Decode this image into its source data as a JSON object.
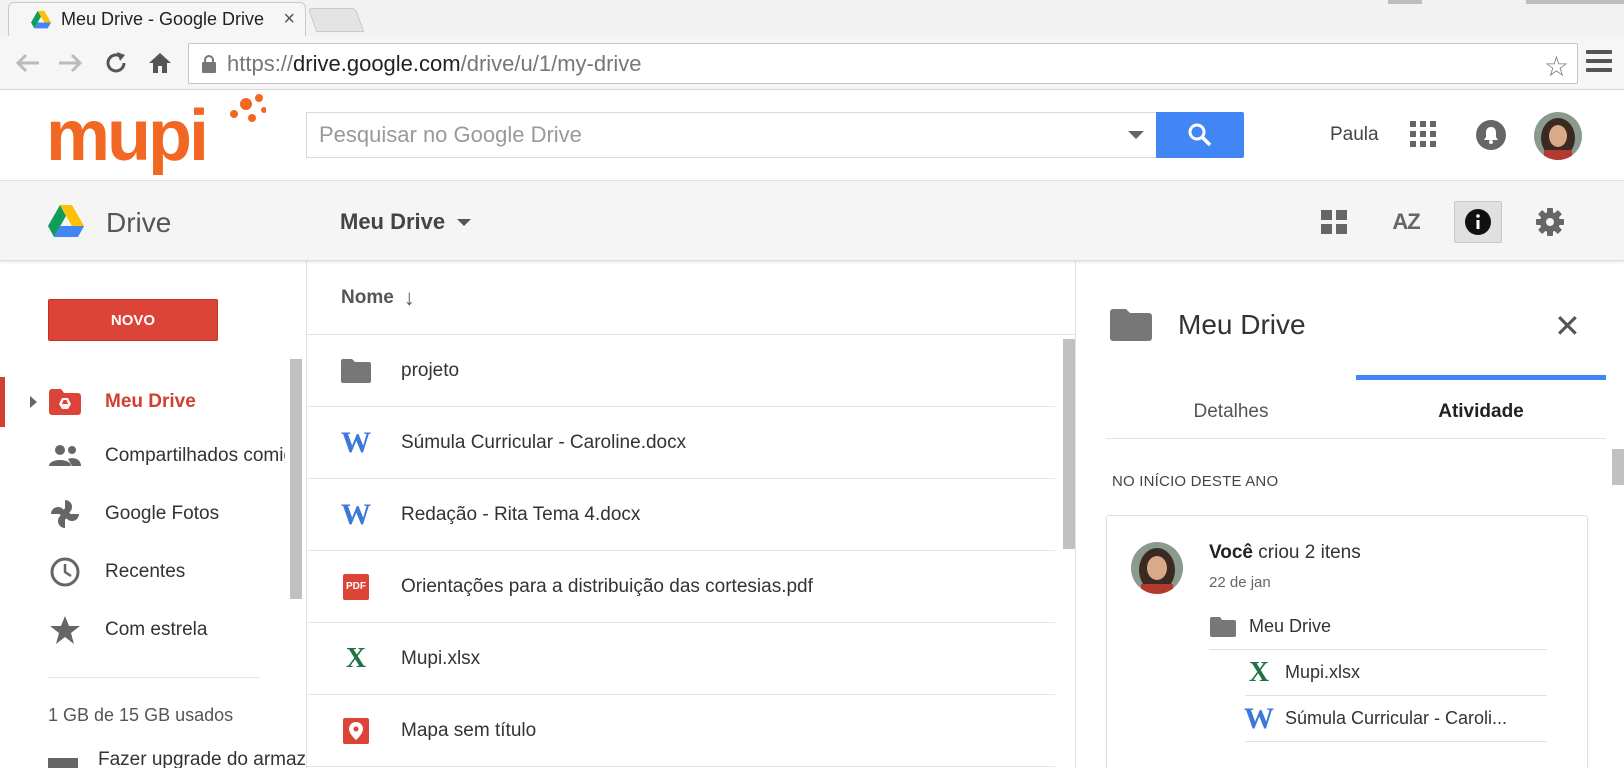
{
  "browser": {
    "tab_title": "Meu Drive - Google Drive",
    "tab_close": "×",
    "url_scheme": "https://",
    "url_host": "drive.google.com",
    "url_path": "/drive/u/1/my-drive"
  },
  "header": {
    "logo_text": "mupi",
    "search_placeholder": "Pesquisar no Google Drive",
    "user_name": "Paula"
  },
  "drivebar": {
    "product_label": "Drive",
    "breadcrumb": "Meu Drive",
    "sort_label": "AZ"
  },
  "sidebar": {
    "new_button": "NOVO",
    "items": [
      {
        "label": "Meu Drive",
        "icon": "my-drive-icon",
        "active": true
      },
      {
        "label": "Compartilhados comigo",
        "icon": "people-icon"
      },
      {
        "label": "Google Fotos",
        "icon": "photos-icon"
      },
      {
        "label": "Recentes",
        "icon": "clock-icon"
      },
      {
        "label": "Com estrela",
        "icon": "star-icon"
      }
    ],
    "storage": "1 GB de 15 GB usados",
    "upgrade": "Fazer upgrade do armazenamento"
  },
  "filelist": {
    "column_name": "Nome",
    "sort_arrow": "↓",
    "files": [
      {
        "name": "projeto",
        "type": "folder"
      },
      {
        "name": "Súmula Curricular - Caroline.docx",
        "type": "word"
      },
      {
        "name": "Redação - Rita Tema 4.docx",
        "type": "word"
      },
      {
        "name": "Orientações para a distribuição das cortesias.pdf",
        "type": "pdf"
      },
      {
        "name": "Mupi.xlsx",
        "type": "excel"
      },
      {
        "name": "Mapa sem título",
        "type": "map"
      }
    ]
  },
  "details": {
    "title": "Meu Drive",
    "close": "✕",
    "tabs": [
      "Detalhes",
      "Atividade"
    ],
    "active_tab": "Atividade",
    "period": "NO INÍCIO DESTE ANO",
    "activity": {
      "actor": "Você",
      "action": " criou 2 itens",
      "date": "22 de jan",
      "folder": "Meu Drive",
      "items": [
        {
          "name": "Mupi.xlsx",
          "type": "excel"
        },
        {
          "name": "Súmula Curricular - Caroli...",
          "type": "word"
        }
      ]
    }
  },
  "icon_glyphs": {
    "word": "W",
    "excel": "X",
    "pdf": "PDF"
  },
  "colors": {
    "accent_red": "#db4437",
    "google_blue": "#4285f4",
    "mupi_orange": "#f26722"
  }
}
